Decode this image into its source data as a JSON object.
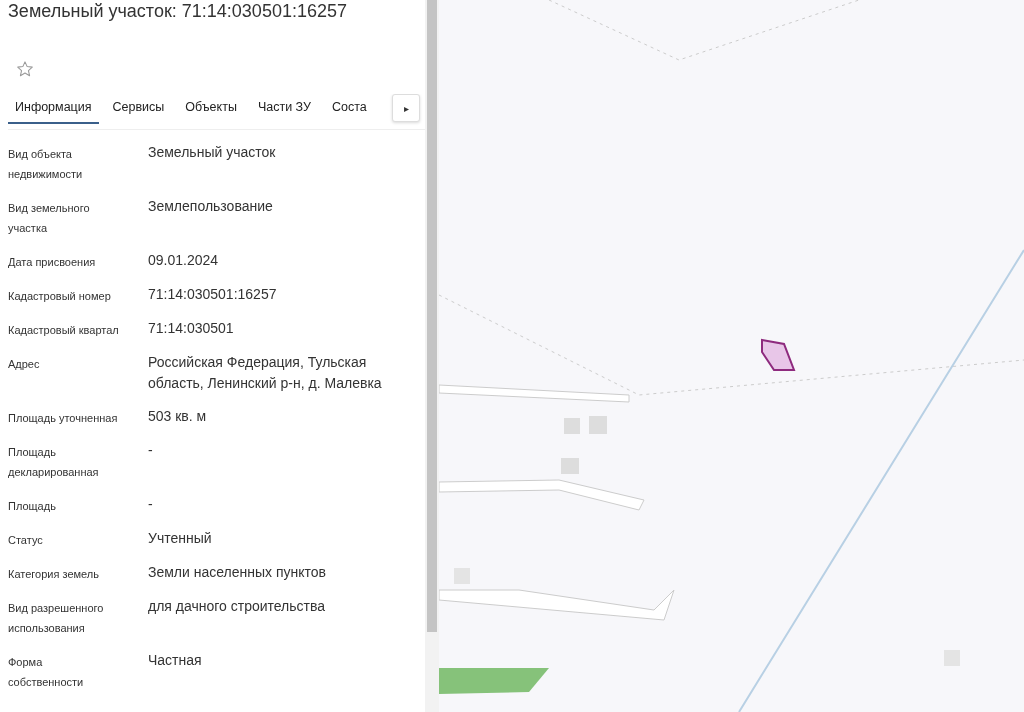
{
  "panel": {
    "title": "Земельный участок: 71:14:030501:16257",
    "favorite": false,
    "tabs": [
      {
        "label": "Информация",
        "selected": true
      },
      {
        "label": "Сервисы",
        "selected": false
      },
      {
        "label": "Объекты",
        "selected": false
      },
      {
        "label": "Части ЗУ",
        "selected": false
      },
      {
        "label": "Соста",
        "selected": false
      }
    ],
    "tabs_next": "▸",
    "fields": [
      {
        "label": "Вид объекта недвижимости",
        "value": "Земельный участок"
      },
      {
        "label": "Вид земельного участка",
        "value": "Землепользование"
      },
      {
        "label": "Дата присвоения",
        "value": "09.01.2024"
      },
      {
        "label": "Кадастровый номер",
        "value": "71:14:030501:16257"
      },
      {
        "label": "Кадастровый квартал",
        "value": "71:14:030501"
      },
      {
        "label": "Адрес",
        "value": "Российская Федерация, Тульская область, Ленинский р-н, д. Малевка"
      },
      {
        "label": "Площадь уточненная",
        "value": "503 кв. м"
      },
      {
        "label": "Площадь декларированная",
        "value": "-"
      },
      {
        "label": "Площадь",
        "value": "-"
      },
      {
        "label": "Статус",
        "value": "Учтенный"
      },
      {
        "label": "Категория земель",
        "value": "Земли населенных пунктов"
      },
      {
        "label": "Вид разрешенного использования",
        "value": "для дачного строительства"
      },
      {
        "label": "Форма собственности",
        "value": "Частная"
      }
    ]
  }
}
